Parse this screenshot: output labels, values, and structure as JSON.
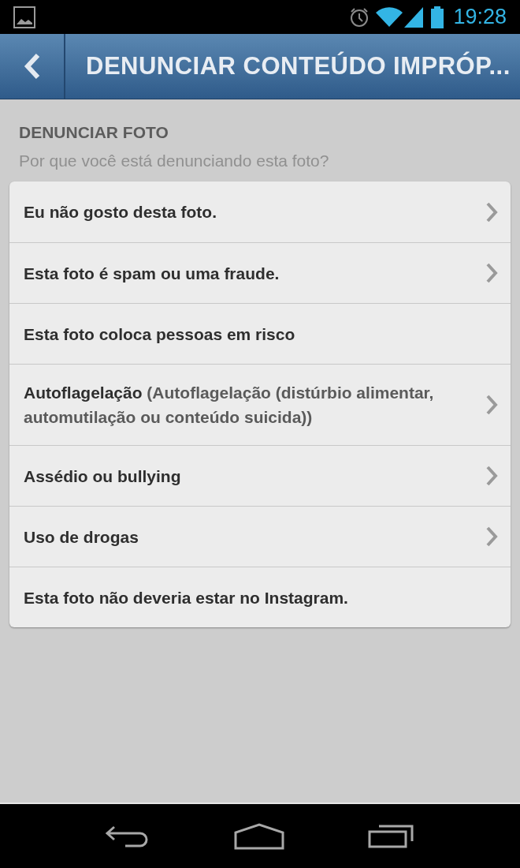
{
  "status_bar": {
    "time": "19:28"
  },
  "header": {
    "title": "DENUNCIAR CONTEÚDO IMPRÓP..."
  },
  "section": {
    "title": "DENUNCIAR FOTO",
    "subtitle": "Por que você está denunciando esta foto?"
  },
  "options": [
    {
      "label": "Eu não gosto desta foto.",
      "has_chevron": true
    },
    {
      "label": "Esta foto é spam ou uma fraude.",
      "has_chevron": true
    },
    {
      "label": "Esta foto coloca pessoas em risco",
      "has_chevron": false
    },
    {
      "label": "Autoflagelação",
      "detail": "(Autoflagelação (distúrbio alimentar, automutilação ou conteúdo suicida))",
      "has_chevron": true
    },
    {
      "label": "Assédio ou bullying",
      "has_chevron": true
    },
    {
      "label": "Uso de drogas",
      "has_chevron": true
    },
    {
      "label": "Esta foto não deveria estar no Instagram.",
      "has_chevron": false
    }
  ]
}
